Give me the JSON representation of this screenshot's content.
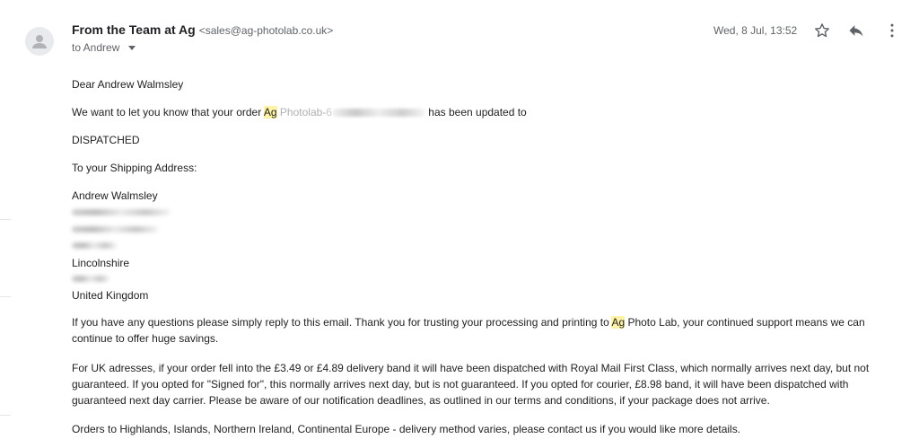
{
  "sender": {
    "name": "From the Team at Ag",
    "email": "<sales@ag-photolab.co.uk>",
    "to_label": "to Andrew"
  },
  "date": "Wed, 8 Jul, 13:52",
  "icons": {
    "avatar": "person-icon",
    "star": "star-icon",
    "reply": "reply-icon",
    "more": "more-vert-icon",
    "caret": "caret-down-icon"
  },
  "colors": {
    "highlight": "#fff3a6",
    "muted": "#5f6368"
  },
  "body": {
    "greeting": "Dear Andrew Walmsley",
    "order_pre": "We want to let you know that your order ",
    "order_hl": "Ag",
    "order_mid": " Photolab-",
    "order_masked": "6",
    "order_post": " has been updated to",
    "status": "DISPATCHED",
    "shipping_label": "To your Shipping Address:",
    "address_name": "Andrew Walmsley",
    "address_county": "Lincolnshire",
    "address_country": "United Kingdom",
    "para1_pre": "If you have any questions please simply reply to this email. Thank you for trusting your processing and printing to ",
    "para1_hl": "Ag",
    "para1_post": " Photo Lab, your continued support means we can continue to offer huge savings.",
    "para2": "For UK adresses, if your order fell into the £3.49 or £4.89 delivery band it will have been dispatched with Royal Mail First Class, which normally arrives next day, but not guaranteed. If you opted for \"Signed for\", this normally arrives next day, but is not guaranteed. If you opted for courier, £8.98 band, it will have been dispatched with guaranteed next day carrier. Please be aware of our notification deadlines, as outlined in our terms and conditions, if your package does not arrive.",
    "para3": "Orders to Highlands, Islands, Northern Ireland, Continental Europe - delivery method varies, please contact us if you would like more details."
  }
}
